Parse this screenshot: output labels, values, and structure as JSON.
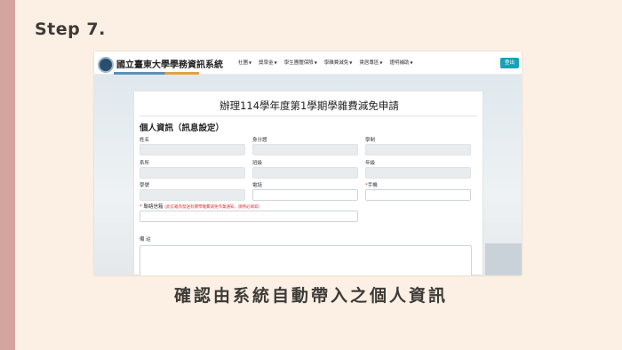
{
  "slide": {
    "step_title": "Step 7.",
    "caption": "確認由系統自動帶入之個人資訊"
  },
  "nav": {
    "logo_text": "國立臺東大學學務資訊系統",
    "items": [
      "社團",
      "獎學金",
      "學生團體保險",
      "學雜費減免",
      "賃居專區",
      "證明補助"
    ],
    "logout_label": "登出"
  },
  "form": {
    "title": "辦理114學年度第1學期學雜費減免申請",
    "section_title": "個人資訊（訊息設定）",
    "labels": {
      "name": "姓名",
      "id_number": "身分證",
      "student_status": "學制",
      "department": "系所",
      "class": "班級",
      "grade": "年級",
      "student_id": "學號",
      "phone": "電話",
      "mobile": "手機",
      "email": "聯絡信箱",
      "email_hint": "(此信箱為發送有關學雜費減免作業通知，請務必填寫)",
      "remarks": "備 註"
    }
  },
  "colors": {
    "slide_bg": "#fcefe3",
    "left_bar": "#d4a49f",
    "accent_button": "#17a2b8",
    "required": "#dd3333"
  }
}
